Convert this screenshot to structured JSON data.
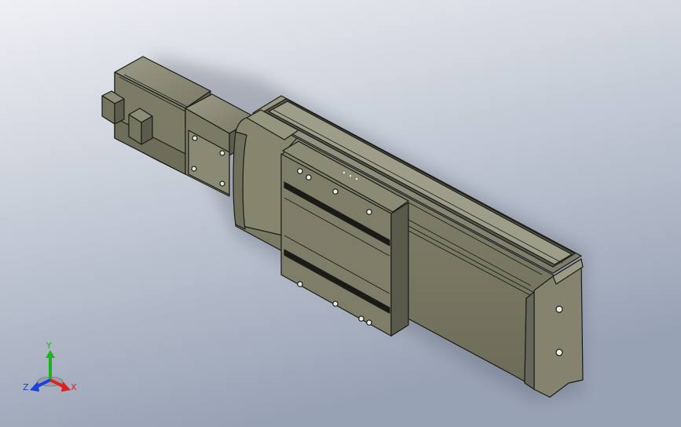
{
  "viewport": {
    "background_top": "#eef0f4",
    "background_bottom": "#98a2b5"
  },
  "model": {
    "body_color": "#7c7c68",
    "body_light": "#8e8e79",
    "body_dark": "#55554a",
    "edge_color": "#1c1c18"
  },
  "triad": {
    "x_label": "X",
    "y_label": "Y",
    "z_label": "Z",
    "x_color": "#e0201a",
    "y_color": "#1fb11f",
    "z_color": "#1e3fe0"
  }
}
